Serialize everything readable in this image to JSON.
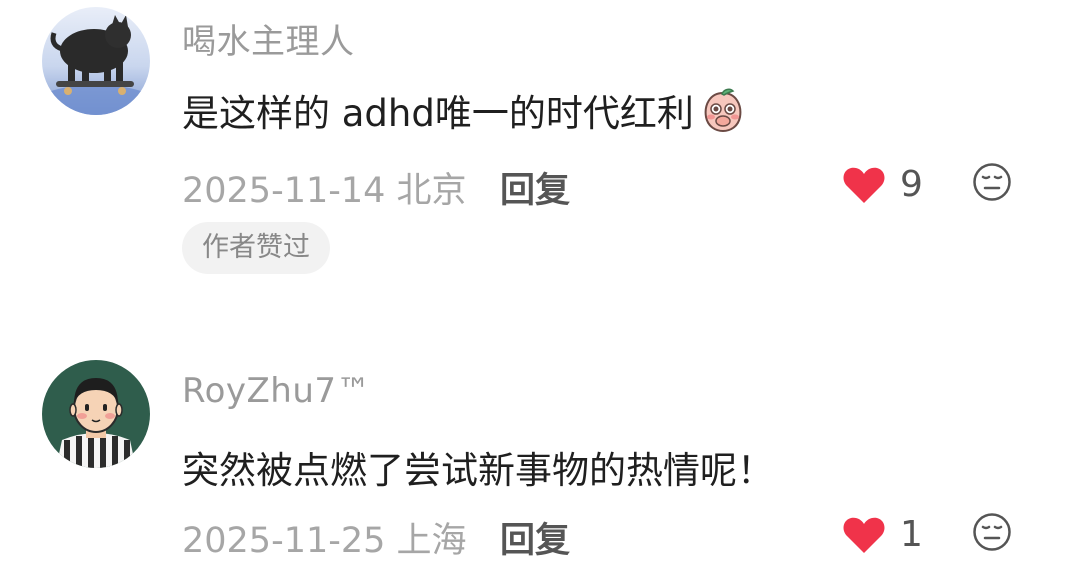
{
  "comments": [
    {
      "username": "喝水主理人",
      "text": "是这样的 adhd唯一的时代红利",
      "date_location": "2025-11-14 北京",
      "reply_label": "回复",
      "like_count": "9",
      "badge": "作者赞过",
      "avatar_icon": "cat-on-skateboard-avatar",
      "sticker_icon": "peach-shy-sticker"
    },
    {
      "username": "RoyZhu7™",
      "text": "突然被点燃了尝试新事物的热情呢！",
      "date_location": "2025-11-25 上海",
      "reply_label": "回复",
      "like_count": "1",
      "avatar_icon": "cartoon-footballer-avatar"
    }
  ],
  "colors": {
    "like_red": "#f0334a",
    "meta_gray": "#a6a6a6",
    "username_gray": "#9a9a9a",
    "badge_bg": "#f2f2f2"
  }
}
